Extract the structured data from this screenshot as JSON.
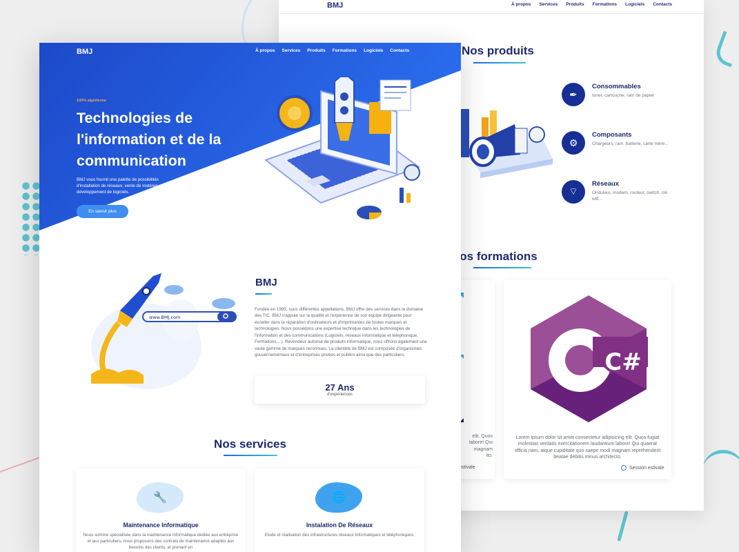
{
  "back_page": {
    "logo": "BMJ",
    "nav": [
      "À propos",
      "Services",
      "Produits",
      "Formations",
      "Logiciels",
      "Contacts"
    ],
    "products": {
      "title": "Nos produits",
      "items": [
        {
          "title": "Consommables",
          "desc": "toner, cartouche, ram de papier",
          "icon": "ink-icon"
        },
        {
          "title": "Composants",
          "desc": "Chargeurs, ram, batterie, carte mère...",
          "icon": "gear-icon"
        },
        {
          "title": "Réseaux",
          "desc": "Onduleur, modem, routeur, switch, clé wifi...",
          "icon": "wifi-icon"
        }
      ]
    },
    "trainings": {
      "title": "Nos formations",
      "partial_card": {
        "text": "elit. Quos\nlabore! Qui\nmagnam\nito.",
        "session": "Session estivale"
      },
      "card": {
        "text": "Lorem ipsum dolor sit amet consectetur adipisicing elit. Quos fugiat molestias veritatis exercitationem laudantium labore! Qui quaerat officia nam, atque cupiditate quo saepe modi magnam reprehenderit beatae debitis minus architecto.",
        "session": "Session estivale",
        "logo_text": "C#"
      }
    }
  },
  "front_page": {
    "logo": "BMJ",
    "nav": [
      "À propos",
      "Services",
      "Produits",
      "Formations",
      "Logiciels",
      "Contacts"
    ],
    "hero": {
      "tagline": "100% algérienne",
      "title": "Technologies de l'information et de la communication",
      "text": "BMJ vous fournit une palette de possibilités d'installation de réseaux, vente de matériel et développement de logiciels.",
      "button": "En savoir plus"
    },
    "about": {
      "search_text": "www.BMJ.com",
      "title": "BMJ",
      "text": "Fondée en 1995, sous différentes appellations, BMJ offre des services dans le domaine des TIC. BMJ s'appuie sur la qualité et l'expérience de son équipe dirigeante pour exceller dans la réparation d'ordinateurs et d'imprimantes de toutes marques et technologies. Nous possédons une expertise technique dans les technologies de l'information et des communications (Logiciels, réseaux informatique et téléphonique, Formations,...). Revendeur autorisé de produits informatique, nous offrons également une vaste gamme de marques reconnues. La clientèle de BMJ est composée d'organismes gouvernementaux et d'entreprises privées et publics ainsi que des particuliers.",
      "years_value": "27 Ans",
      "years_label": "d'expériences"
    },
    "services": {
      "title": "Nos services",
      "items": [
        {
          "title": "Maintenance Informatique",
          "desc": "Nous somme spécialisée dans la maintenance informatique dédiée aux entreprise et aux particuliers, nous proposons des contrats de maintenance adaptés aux besoins des clients, et prenant en",
          "icon": "wrench-icon"
        },
        {
          "title": "Instalation De Réseaux",
          "desc": "Etude et réalisation des infrastructures réseaux informatiques et téléphoniques.",
          "icon": "globe-icon"
        }
      ]
    }
  },
  "colors": {
    "navy": "#1d2a6b",
    "hero_blue": "#1d49d6",
    "accent_teal": "#38c7d3",
    "accent_orange": "#f4a261",
    "csharp_purple": "#9b4f96"
  }
}
